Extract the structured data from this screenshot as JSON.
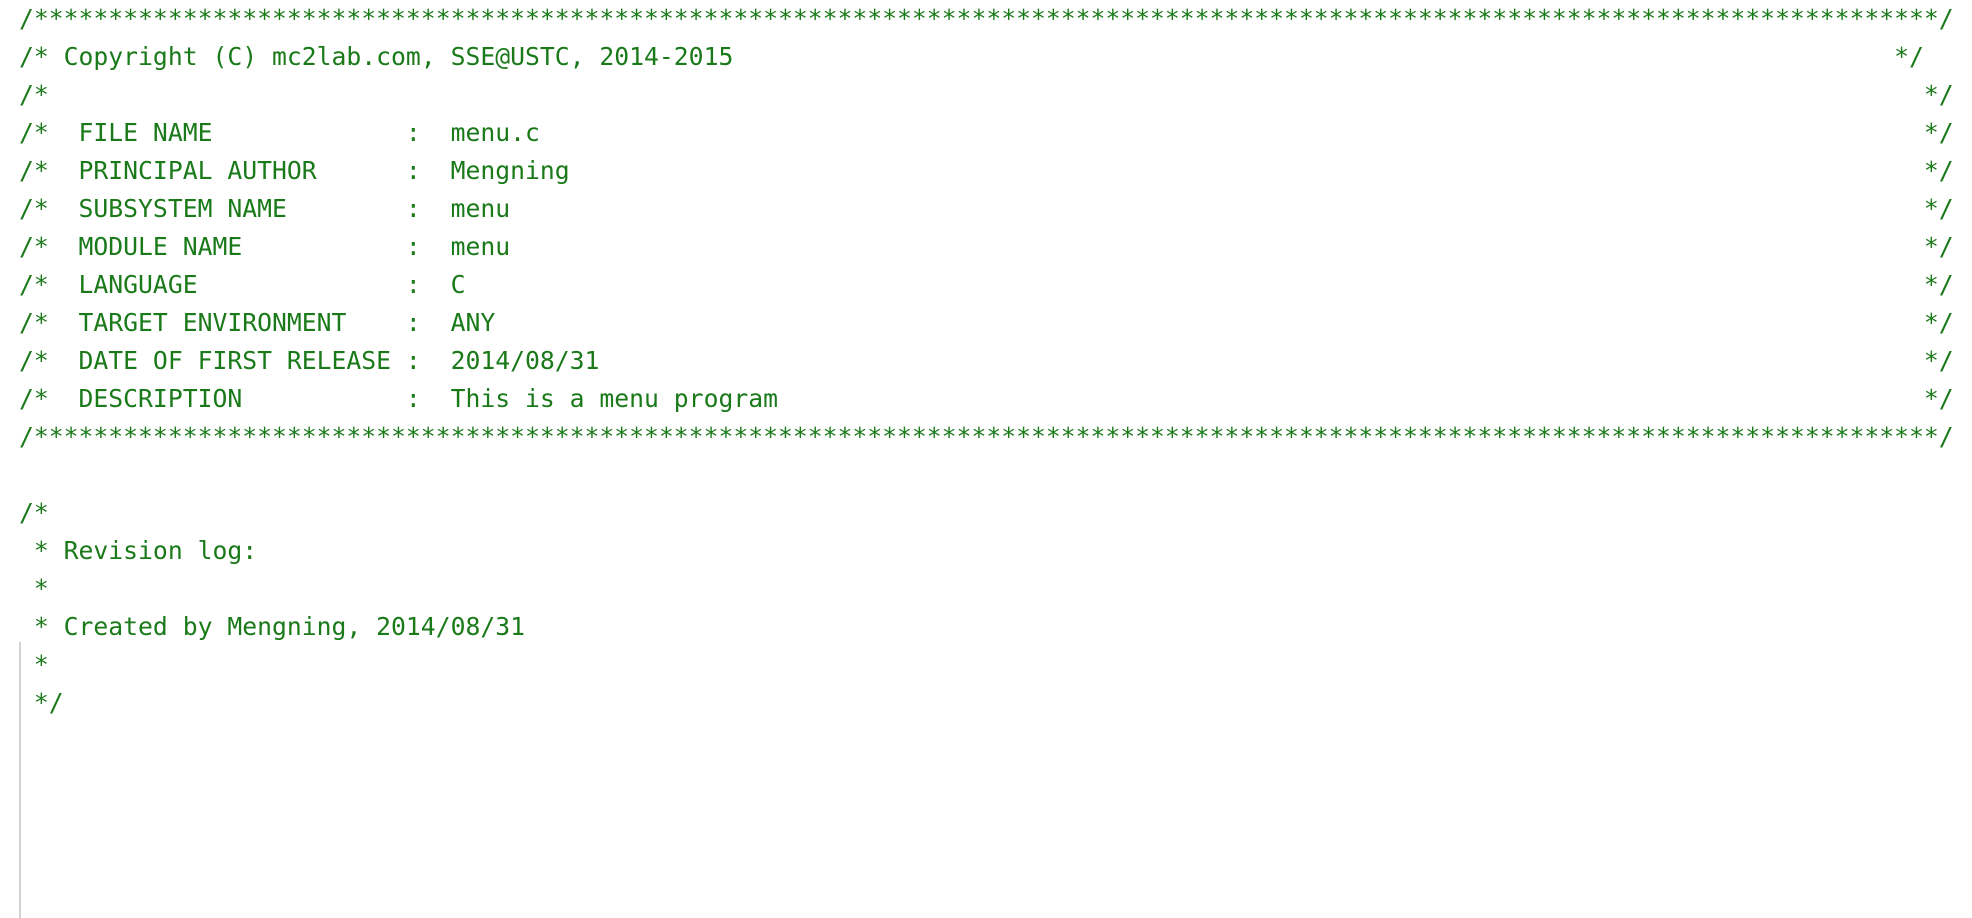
{
  "editor": {
    "file_name": "menu.c",
    "language": "C",
    "background_color": "#ffffff",
    "comment_color": "#1a7a1a",
    "indent_guide_color": "#d2d2d2"
  },
  "banner_comment": {
    "separator_top": "/******************************************************************************/",
    "copyright_line": "/* Copyright (C) mc2lab.com, SSE@USTC, 2014-2015",
    "copyright_close": "*/",
    "empty_line": "/*",
    "empty_line_close": "*/",
    "fields": [
      {
        "label": "FILE NAME",
        "separator": ":",
        "value": "menu.c"
      },
      {
        "label": "PRINCIPAL AUTHOR",
        "separator": ":",
        "value": "Mengning"
      },
      {
        "label": "SUBSYSTEM NAME",
        "separator": ":",
        "value": "menu"
      },
      {
        "label": "MODULE NAME",
        "separator": ":",
        "value": "menu"
      },
      {
        "label": "LANGUAGE",
        "separator": ":",
        "value": "C"
      },
      {
        "label": "TARGET ENVIRONMENT",
        "separator": ":",
        "value": "ANY"
      },
      {
        "label": "DATE OF FIRST RELEASE",
        "separator": ":",
        "value": "2014/08/31"
      },
      {
        "label": "DESCRIPTION",
        "separator": ":",
        "value": "This is a menu program"
      }
    ],
    "comment_open": "/*",
    "comment_close": "*/",
    "separator_bottom": "/******************************************************************************/"
  },
  "revision_comment": {
    "open": "/*",
    "lines": [
      " * Revision log:",
      " *",
      " * Created by Mengning, 2014/08/31",
      " *"
    ],
    "close": " */"
  },
  "rendered_lines": [
    "/********************************************************************************************************************************/",
    "/* Copyright (C) mc2lab.com, SSE@USTC, 2014-2015                                                                              */",
    "/*                                                                                                                              */",
    "/*  FILE NAME             :  menu.c                                                                                             */",
    "/*  PRINCIPAL AUTHOR      :  Mengning                                                                                           */",
    "/*  SUBSYSTEM NAME        :  menu                                                                                               */",
    "/*  MODULE NAME           :  menu                                                                                               */",
    "/*  LANGUAGE              :  C                                                                                                  */",
    "/*  TARGET ENVIRONMENT    :  ANY                                                                                                */",
    "/*  DATE OF FIRST RELEASE :  2014/08/31                                                                                         */",
    "/*  DESCRIPTION           :  This is a menu program                                                                             */",
    "/********************************************************************************************************************************/",
    "",
    "/*",
    " * Revision log:",
    " *",
    " * Created by Mengning, 2014/08/31",
    " *",
    " */"
  ]
}
